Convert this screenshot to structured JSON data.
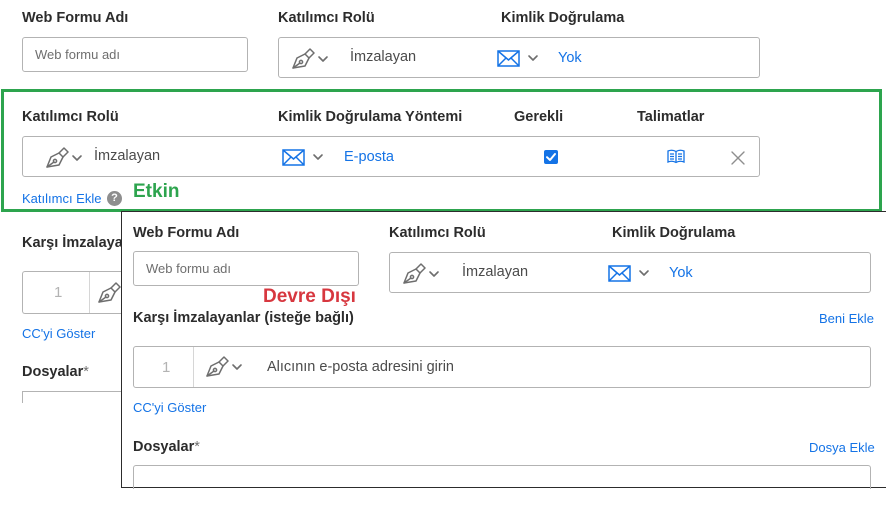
{
  "top_section": {
    "web_form_name_label": "Web Formu Adı",
    "web_form_name_placeholder": "Web formu adı",
    "participant_role_label": "Katılımcı Rolü",
    "role_value": "İmzalayan",
    "auth_label": "Kimlik Doğrulama",
    "auth_value": "Yok"
  },
  "enabled_panel": {
    "participant_role_label": "Katılımcı Rolü",
    "auth_method_label": "Kimlik Doğrulama Yöntemi",
    "required_label": "Gerekli",
    "instructions_label": "Talimatlar",
    "role_value": "İmzalayan",
    "auth_value": "E-posta",
    "required_checked": true,
    "add_participant_link": "Katılımcı Ekle",
    "help_icon_glyph": "?",
    "callout": "Etkin",
    "border_color": "#2da44e"
  },
  "background_form": {
    "countersigners_label_partial": "Karşı İmzalaya",
    "row_number": "1",
    "show_cc_link": "CC'yi Göster",
    "files_label": "Dosyalar",
    "required_mark": "*"
  },
  "disabled_panel": {
    "callout": "Devre Dışı",
    "callout_color": "#d7373f",
    "web_form_name_label": "Web Formu Adı",
    "web_form_name_placeholder": "Web formu adı",
    "participant_role_label": "Katılımcı Rolü",
    "role_value": "İmzalayan",
    "auth_label": "Kimlik Doğrulama",
    "auth_value": "Yok",
    "countersigners_label": "Karşı İmzalayanlar (isteğe bağlı)",
    "add_me_link": "Beni Ekle",
    "row_number": "1",
    "recipient_placeholder": "Alıcının e-posta adresini girin",
    "show_cc_link": "CC'yi Göster",
    "files_label": "Dosyalar",
    "required_mark": "*",
    "add_file_link": "Dosya Ekle"
  },
  "icons": {
    "pen": "pen-icon",
    "chevron": "chevron-down-icon",
    "mail": "mail-icon",
    "book": "book-icon",
    "close": "close-icon",
    "checkbox": "checkbox-checked-icon",
    "help": "help-icon"
  }
}
